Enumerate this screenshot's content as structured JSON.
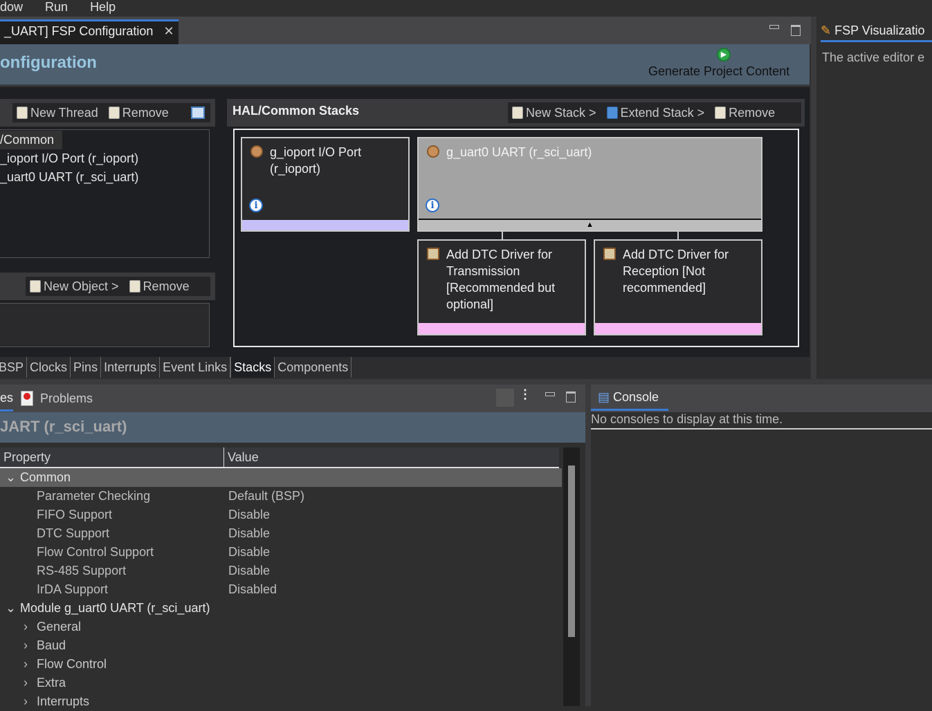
{
  "menu": [
    "dow",
    "Run",
    "Help"
  ],
  "editor": {
    "tab_title": "_UART] FSP Configuration",
    "header_title": "onfiguration",
    "generate_label": "Generate Project Content"
  },
  "threads": {
    "new_thread": "New Thread",
    "remove": "Remove",
    "items": [
      "/Common",
      "_ioport I/O Port (r_ioport)",
      "_uart0 UART (r_sci_uart)"
    ],
    "new_object": "New Object >",
    "remove_obj": "Remove"
  },
  "stacks": {
    "title": "HAL/Common Stacks",
    "new_stack": "New Stack >",
    "extend_stack": "Extend Stack >",
    "remove": "Remove",
    "modules": [
      {
        "name": "g_ioport I/O Port (r_ioport)"
      },
      {
        "name": "g_uart0 UART (r_sci_uart)"
      }
    ],
    "dependencies": [
      {
        "name": "Add DTC Driver for Transmission [Recommended but optional]"
      },
      {
        "name": "Add DTC Driver for Reception [Not recommended]"
      }
    ],
    "colors": {
      "ioport_bar": "#c7bff7",
      "dtc_bar": "#f6b6f4",
      "selected_module": "#a3a3a3"
    }
  },
  "editor_tabs": [
    "BSP",
    "Clocks",
    "Pins",
    "Interrupts",
    "Event Links",
    "Stacks",
    "Components"
  ],
  "active_editor_tab": "Stacks",
  "viz": {
    "title": "FSP Visualizatio",
    "message": "The active editor e"
  },
  "bottom": {
    "tab_partial": "es",
    "problems": "Problems",
    "section_title": "JART (r_sci_uart)",
    "col_property": "Property",
    "col_value": "Value",
    "rows": [
      {
        "type": "group",
        "label": "Common",
        "expanded": true
      },
      {
        "k": "Parameter Checking",
        "v": "Default (BSP)"
      },
      {
        "k": "FIFO Support",
        "v": "Disable"
      },
      {
        "k": "DTC Support",
        "v": "Disable"
      },
      {
        "k": "Flow Control Support",
        "v": "Disable"
      },
      {
        "k": "RS-485 Support",
        "v": "Disable"
      },
      {
        "k": "IrDA Support",
        "v": "Disabled"
      },
      {
        "type": "group",
        "label": "Module g_uart0 UART (r_sci_uart)",
        "expanded": true
      },
      {
        "type": "sub",
        "label": "General"
      },
      {
        "type": "sub",
        "label": "Baud"
      },
      {
        "type": "sub",
        "label": "Flow Control"
      },
      {
        "type": "sub",
        "label": "Extra"
      },
      {
        "type": "sub",
        "label": "Interrupts"
      }
    ]
  },
  "console": {
    "title": "Console",
    "message": "No consoles to display at this time."
  }
}
